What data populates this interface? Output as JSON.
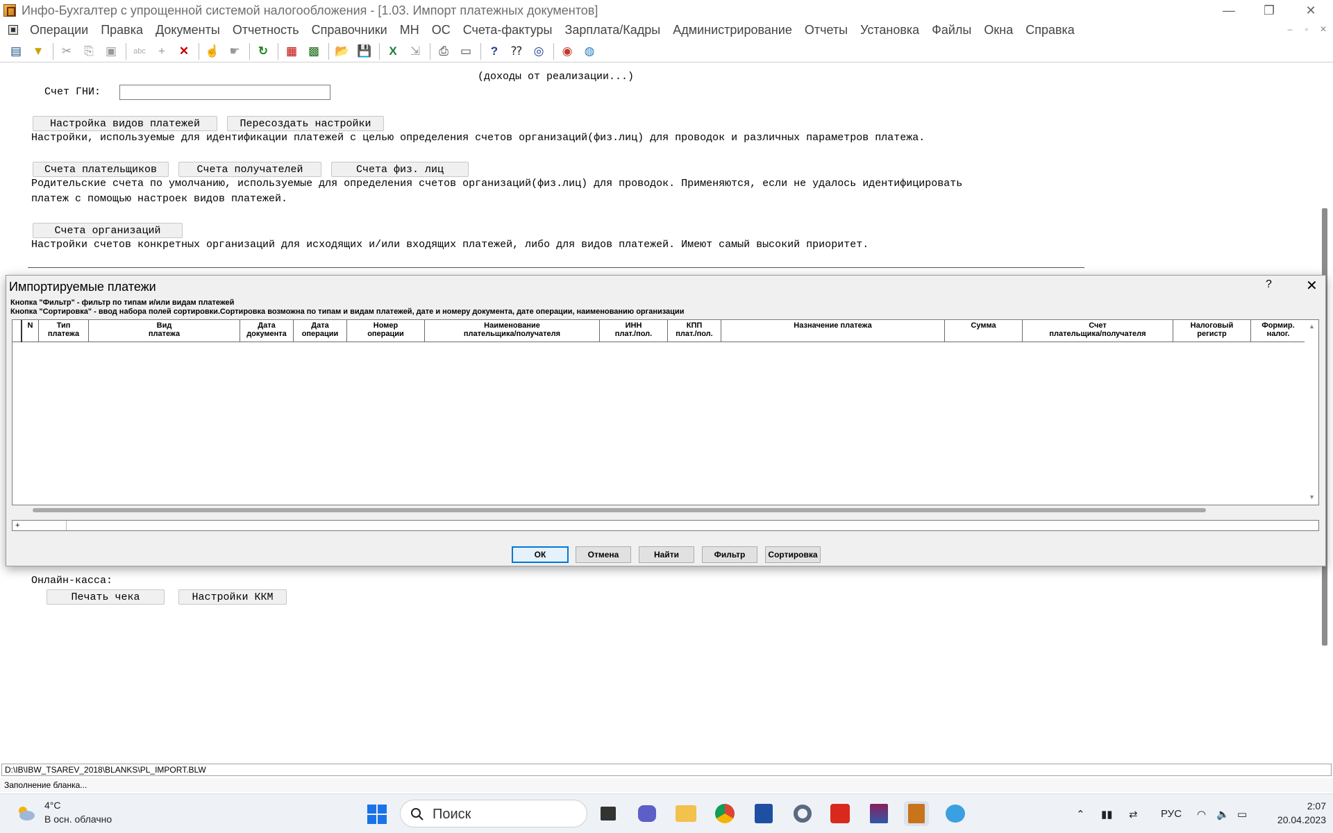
{
  "window": {
    "title": "Инфо-Бухгалтер с упрощенной системой налогообложения - [1.03. Импорт платежных документов]"
  },
  "menu": [
    "Операции",
    "Правка",
    "Документы",
    "Отчетность",
    "Справочники",
    "МН",
    "ОС",
    "Счета-фактуры",
    "Зарплата/Кадры",
    "Администрирование",
    "Отчеты",
    "Установка",
    "Файлы",
    "Окна",
    "Справка"
  ],
  "form": {
    "income_note": "(доходы от реализации...)",
    "gni_label": "Счет ГНИ:",
    "gni_value": "",
    "btn_payment_types": "Настройка видов платежей",
    "btn_recreate": "Пересоздать настройки",
    "desc_payment_types": "Настройки, используемые для идентификации платежей с целью определения счетов организаций(физ.лиц) для проводок и различных параметров платежа.",
    "btn_payers": "Счета плательщиков",
    "btn_receivers": "Счета получателей",
    "btn_individuals": "Счета физ. лиц",
    "desc_parent_line1": "Родительские счета по умолчанию, используемые для определения счетов организаций(физ.лиц) для проводок. Применяются, если не удалось идентифицировать",
    "desc_parent_line2": "платеж с помощью настроек видов платежей.",
    "btn_org_accounts": "Счета организаций",
    "desc_org_accounts": "Настройки счетов конкретных организаций для исходящих и/или входящих платежей, либо для видов платежей. Имеют самый высокий приоритет.",
    "online_label": "Онлайн-касса:",
    "btn_print_receipt": "Печать чека",
    "btn_kkm_settings": "Настройки ККМ"
  },
  "dialog": {
    "title": "Импортируемые платежи",
    "help": "?",
    "close": "✕",
    "hint1": "Кнопка \"Фильтр\"  - фильтр по типам и/или видам платежей",
    "hint2": "Кнопка \"Сортировка\" - ввод набора полей сортировки.Сортировка возможна по типам и видам платежей, дате и номеру документа, дате операции, наименованию организации",
    "columns": [
      "N",
      "Тип\nплатежа",
      "Вид\nплатежа",
      "Дата\nдокумента",
      "Дата\nоперации",
      "Номер\nоперации",
      "Наименование\nплательщика/получателя",
      "ИНН\nплат./пол.",
      "КПП\nплат./пол.",
      "Назначение платежа",
      "Сумма",
      "Счет\nплательщика/получателя",
      "Налоговый\nрегистр",
      "Формир.\nналог."
    ],
    "status_cell": "+",
    "buttons": {
      "ok": "ОК",
      "cancel": "Отмена",
      "find": "Найти",
      "filter": "Фильтр",
      "sort": "Сортировка"
    }
  },
  "path": "D:\\IB\\IBW_TSAREV_2018\\BLANKS\\PL_IMPORT.BLW",
  "status": "Заполнение бланка...",
  "taskbar": {
    "temp": "4°C",
    "weather": "В осн. облачно",
    "search_placeholder": "Поиск",
    "lang": "РУС",
    "time": "2:07",
    "date": "20.04.2023"
  },
  "colors": {
    "accent": "#0078d7",
    "taskbar": "#eef1f6"
  }
}
